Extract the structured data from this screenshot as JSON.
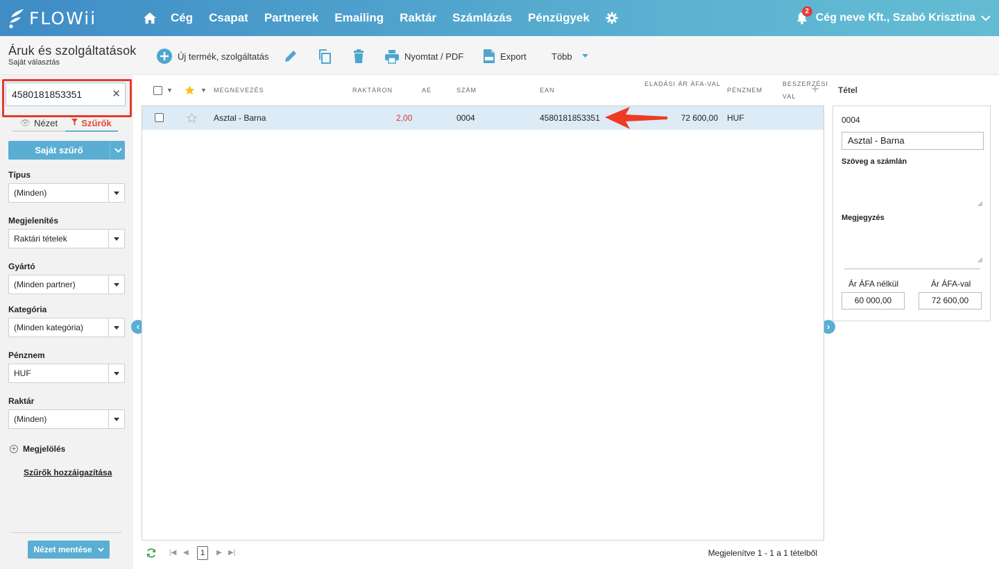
{
  "app": {
    "logo_text": "FLOWii"
  },
  "nav": {
    "items": [
      "Cég",
      "Csapat",
      "Partnerek",
      "Emailing",
      "Raktár",
      "Számlázás",
      "Pénzügyek"
    ],
    "notification_count": "2",
    "user_label": "Cég neve Kft., Szabó Krisztina"
  },
  "toolbar": {
    "title": "Áruk és szolgáltatások",
    "subtitle": "Saját választás",
    "new_label": "Új termék, szolgáltatás",
    "print_label": "Nyomtat / PDF",
    "export_label": "Export",
    "more_label": "Több"
  },
  "sidebar": {
    "search_value": "4580181853351",
    "tab_view": "Nézet",
    "tab_filters": "Szűrők",
    "own_filter_label": "Saját szűrő",
    "filters": [
      {
        "label": "Típus",
        "value": "(Minden)"
      },
      {
        "label": "Megjelenítés",
        "value": "Raktári tételek"
      },
      {
        "label": "Gyártó",
        "value": "(Minden partner)"
      },
      {
        "label": "Kategória",
        "value": "(Minden kategória)"
      },
      {
        "label": "Pénznem",
        "value": "HUF"
      },
      {
        "label": "Raktár",
        "value": "(Minden)"
      }
    ],
    "mark_label": "Megjelölés",
    "assign_label": "Szűrők hozzáigazítása",
    "save_view_label": "Nézet mentése"
  },
  "grid": {
    "columns": {
      "name": "Megnevezés",
      "stock": "Raktáron",
      "unit": "AE",
      "number": "Szám",
      "ean": "EAN",
      "sale_price_1": "Eladási ár ÁFA-val",
      "currency": "Pénznem",
      "purchase_1": "Beszerzési",
      "purchase_2": "val"
    },
    "rows": [
      {
        "name": "Asztal - Barna",
        "stock": "2,00",
        "number": "0004",
        "ean": "4580181853351",
        "sale_price": "72 600,00",
        "currency": "HUF"
      }
    ],
    "pager": {
      "page": "1",
      "info": "Megjelenítve 1 - 1 a 1 tételből"
    }
  },
  "detail": {
    "title": "Tétel",
    "code": "0004",
    "name": "Asztal - Barna",
    "invoice_text_label": "Szöveg a számlán",
    "note_label": "Megjegyzés",
    "net_label": "Ár ÁFA nélkül",
    "gross_label": "Ár ÁFA-val",
    "net_value": "60 000,00",
    "gross_value": "72 600,00"
  },
  "colors": {
    "accent": "#5aaed3",
    "highlight": "#e53a2a",
    "row_selected": "#dcebf5",
    "negative_stock": "#d9363e"
  }
}
